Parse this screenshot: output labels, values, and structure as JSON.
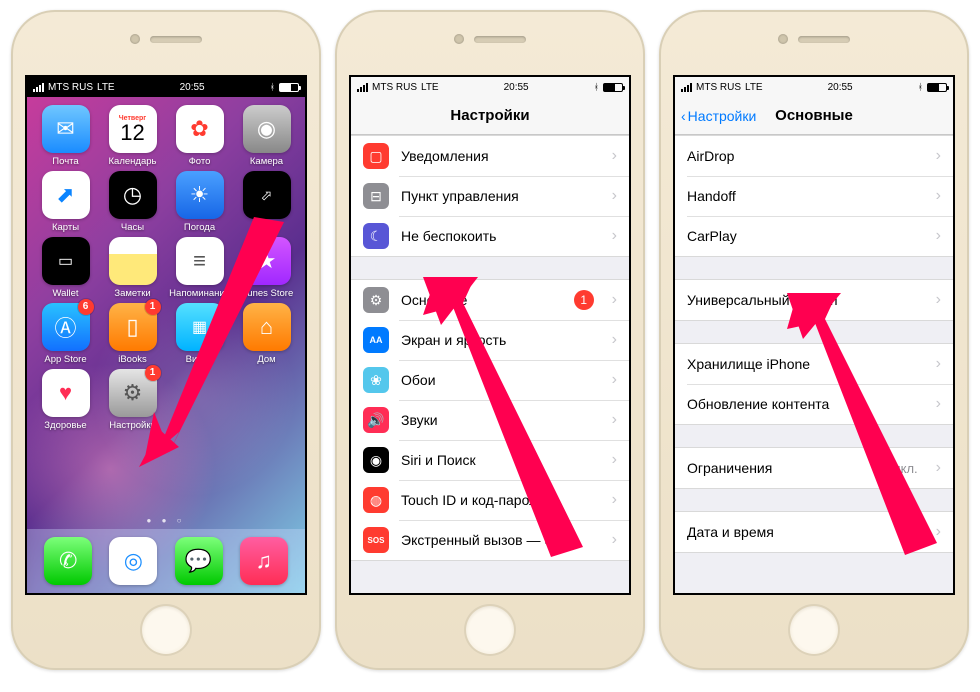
{
  "status": {
    "carrier": "MTS RUS",
    "net": "LTE",
    "time": "20:55"
  },
  "home": {
    "cal_day": "Четверг",
    "cal_date": "12",
    "apps": {
      "mail": "Почта",
      "calendar": "Календарь",
      "photos": "Фото",
      "camera": "Камера",
      "maps": "Карты",
      "clock": "Часы",
      "weather": "Погода",
      "stocks": "Акции",
      "wallet": "Wallet",
      "notes": "Заметки",
      "reminders": "Напоминания",
      "itunes": "iTunes Store",
      "appstore": "App Store",
      "ibooks": "iBooks",
      "video": "Видео",
      "homekit": "Дом",
      "health": "Здоровье",
      "settings": "Настройки"
    },
    "badges": {
      "appstore": "6",
      "ibooks": "1",
      "settings": "1"
    }
  },
  "settings": {
    "title": "Настройки",
    "rows": {
      "notifications": "Уведомления",
      "control_center": "Пункт управления",
      "dnd": "Не беспокоить",
      "general": "Основные",
      "display": "Экран и яркость",
      "wallpaper": "Обои",
      "sounds": "Звуки",
      "siri": "Siri и Поиск",
      "touchid": "Touch ID и код-пароль",
      "sos": "Экстренный вызов — SOS"
    },
    "general_badge": "1"
  },
  "general": {
    "back": "Настройки",
    "title": "Основные",
    "rows": {
      "airdrop": "AirDrop",
      "handoff": "Handoff",
      "carplay": "CarPlay",
      "accessibility": "Универсальный доступ",
      "storage": "Хранилище iPhone",
      "refresh": "Обновление контента",
      "restrictions": "Ограничения",
      "restrictions_val": "Выкл.",
      "datetime": "Дата и время"
    }
  }
}
